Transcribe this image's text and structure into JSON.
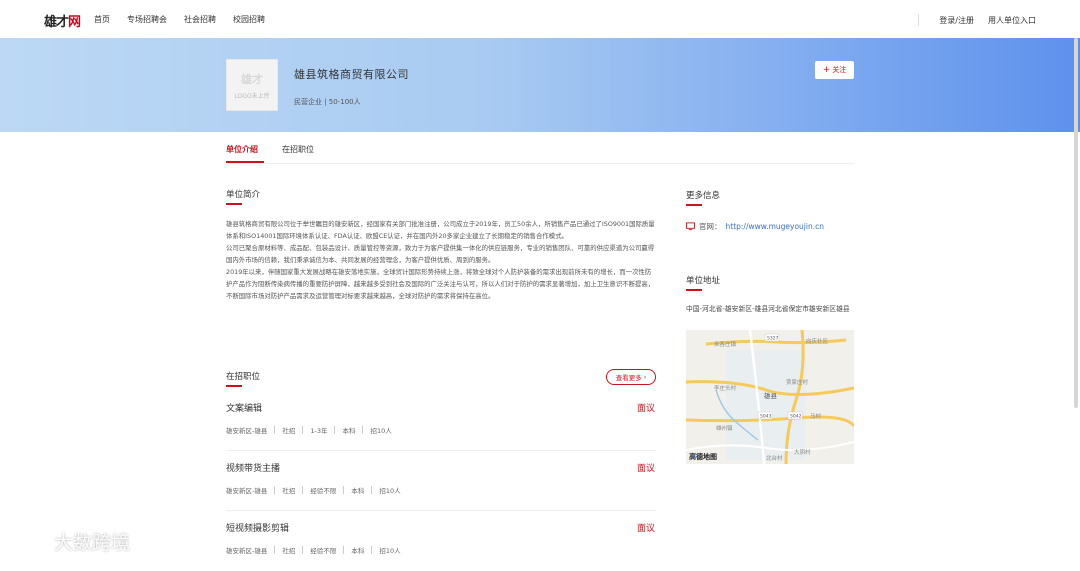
{
  "nav": {
    "logo_a": "雄才",
    "logo_b": "网",
    "links": [
      "首页",
      "专场招聘会",
      "社会招聘",
      "校园招聘"
    ],
    "login": "登录/注册",
    "personal": "用人单位入口"
  },
  "company": {
    "logo_mark": "雄才",
    "logo_caption": "LOGO未上传",
    "name": "雄县筑格商贸有限公司",
    "meta": "民营企业 | 50-100人",
    "follow": "关注"
  },
  "tabs": [
    "单位介绍",
    "在招职位"
  ],
  "intro": {
    "title": "单位简介",
    "paragraphs": [
      "雄县筑格商贸有限公司位于举世瞩目的雄安新区，经国家有关部门批准注册，公司成立于2019年，员工50余人，所销售产品已通过了ISO9001国际质量体系和ISO14001国际环境体系认证、FDA认证、欧盟CE认证，并在国内外20多家企业建立了长期稳定的销售合作模式。",
      "公司已聚合原材料等、成品配、包装品设计、质量管控等资源，致力于为客户提供集一体化的供应链服务，专业的销售团队、可靠的供应渠道为公司赢得国内外市场的信赖，我们秉承诚信为本、共同发展的经营理念，为客户提供优质、周到的服务。",
      "2019年以来，伴随国家重大发展战略在雄安落地实施，全球贸计国际形势持续上涨，将致全球对个人防护装备的需求出现前所未有的增长，而一次性防护产品作为阻断传染病传播的重要防护屏障，越来越多受到社会及国际的广泛关注与认可，所以人们对于防护的需求显著增加，加上卫生意识不断提高，不断国际市场对防护产品需求及运营管理对标要求越来越高，全球对防护的需求将保持在高位。"
    ]
  },
  "jobs": {
    "title": "在招职位",
    "more": "查看更多",
    "items": [
      {
        "title": "文案编辑",
        "salary": "面议",
        "tags": [
          "雄安新区-雄县",
          "社招",
          "1-3年",
          "本科",
          "招10人"
        ]
      },
      {
        "title": "视频带货主播",
        "salary": "面议",
        "tags": [
          "雄安新区-雄县",
          "社招",
          "经验不限",
          "本科",
          "招10人"
        ]
      },
      {
        "title": "短视频摄影剪辑",
        "salary": "面议",
        "tags": [
          "雄安新区-雄县",
          "社招",
          "经验不限",
          "本科",
          "招10人"
        ]
      }
    ]
  },
  "more_info": {
    "title": "更多信息",
    "website_label": "官网：",
    "website": "http://www.mugeyoujin.cn"
  },
  "address": {
    "title": "单位地址",
    "text": "中国-河北省-雄安新区-雄县河北省保定市雄安新区雄县"
  },
  "map": {
    "logo": "高德地图",
    "labels": [
      "米各庄镇",
      "向庆社区",
      "李庄头村",
      "贾家庄村",
      "雄县",
      "雄州镇",
      "大阴村",
      "马村",
      "北台村",
      "5327",
      "5043",
      "5042"
    ]
  },
  "watermark": "大数跨境"
}
